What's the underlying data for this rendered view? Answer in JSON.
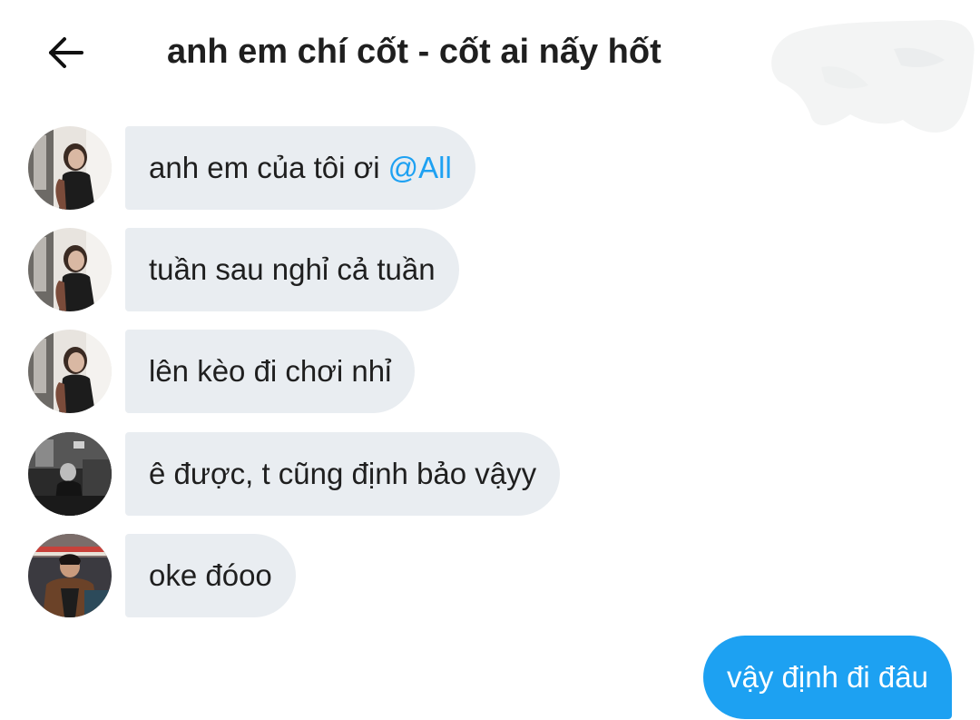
{
  "header": {
    "title": "anh em chí cốt - cốt ai nấy hốt",
    "back_icon": "arrow-left-icon"
  },
  "messages": [
    {
      "sender_avatar": "avatar-girl",
      "text": "anh em của tôi ơi",
      "mention": "@All"
    },
    {
      "sender_avatar": "avatar-girl",
      "text": "tuần sau nghỉ cả tuần"
    },
    {
      "sender_avatar": "avatar-girl",
      "text": "lên kèo đi chơi nhỉ"
    },
    {
      "sender_avatar": "avatar-boy-bw",
      "text": "ê được, t cũng định bảo vậyy"
    },
    {
      "sender_avatar": "avatar-boy-color",
      "text": "oke đóoo"
    }
  ],
  "outgoing": {
    "text": "vậy định đi đâu"
  },
  "colors": {
    "incoming_bubble": "#e9edf1",
    "outgoing_bubble": "#1da1f2",
    "mention": "#1ea1f2",
    "title_text": "#1f1f1f"
  }
}
